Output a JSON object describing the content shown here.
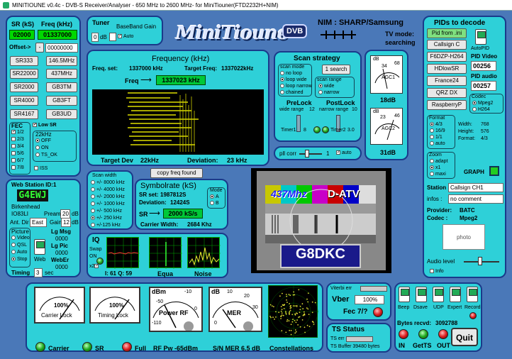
{
  "window_title": "MINITIOUNE v0.4c - DVB-S Receiver/Analyser - 650 MHz to 2600 MHz- for MiniTiouner(FTD2232H+NIM)",
  "left": {
    "sr_header": "SR (kS)",
    "freq_header": "Freq (kHz)",
    "sr_value": "02000",
    "freq_value": "01337000",
    "offset_label": "Offset->",
    "offset_btn": "-",
    "offset_value": "00000000",
    "presets": [
      [
        "SR333",
        "146.5MHz"
      ],
      [
        "SR22000",
        "437MHz"
      ],
      [
        "SR2000",
        "GB3TM"
      ],
      [
        "SR4000",
        "GB3FT"
      ],
      [
        "SR4167",
        "GB3UD"
      ]
    ],
    "fec_title": "FEC",
    "fec_items": [
      "1/2",
      "2/3",
      "3/4",
      "5/6",
      "6/7",
      "7/8"
    ],
    "low_sr": "Low SR",
    "khz22_title": "22kHz",
    "khz22_items": [
      "OFF",
      "ON",
      "TS_OK"
    ],
    "iss": "ISS"
  },
  "web": {
    "title": "Web Station ID:1",
    "callsign": "G4EWJ",
    "location": "Birkenhead",
    "locator": "IO83LI",
    "preamp_label": "Preamp",
    "preamp_value": "20",
    "preamp_unit": "dB",
    "ant_dir_label": "Ant. Dir",
    "ant_dir_value": "East",
    "gain_label": "Gain",
    "gain_value": "12",
    "gain_unit": "dB",
    "picture_title": "Picture",
    "picture_items": [
      "Video",
      "QSL",
      "Auto",
      "Stop"
    ],
    "lg_msg": "Lg Msg",
    "lg_msg_val": "0000",
    "lg_pic": "Lg Pic",
    "lg_pic_val": "0000",
    "weber": "WebEr",
    "weber_val": "0000",
    "web_btn": "Web",
    "timing_label": "Timing",
    "timing_value": "3",
    "timing_unit": "sec"
  },
  "tuner": {
    "title": "Tuner",
    "bb_gain": "BaseBand Gain",
    "gain_value": "0",
    "gain_unit": "dB",
    "auto": "Auto"
  },
  "logo": "MiniTioune",
  "logo_badge": "DVB",
  "nim": "NIM : SHARP/Samsung",
  "tv_mode_label": "TV mode:",
  "tv_mode_value": "searching",
  "frequency": {
    "title": "Frequency (kHz)",
    "freq_set_label": "Freq. set:",
    "freq_set": "1337000 kHz",
    "target_label": "Target Freq:",
    "target": "1337022kHz",
    "freq_arrow_label": "Freq",
    "freq_value": "1337023 kHz",
    "target_dev_label": "Target Dev",
    "target_dev": "22kHz",
    "deviation_label": "Deviation:",
    "deviation": "23 kHz"
  },
  "scan": {
    "title": "Scan strategy",
    "mode_title": "scan mode",
    "modes": [
      "no loop",
      "loop wide",
      "loop narrow",
      "chained"
    ],
    "search_btn": "1 search",
    "range_title": "scan range",
    "ranges": [
      "wide",
      "narrow"
    ],
    "prelock": "PreLock",
    "prelock_sub": "wide range",
    "prelock_val": "12",
    "postlock": "PostLock",
    "postlock_sub": "narrow range",
    "postlock_val": "10",
    "timer1": "Timer1",
    "timer1_val": "8",
    "timer2": "Timer2",
    "timer2_val": "3.0",
    "pll_label": "pll corr",
    "pll_val": "1",
    "auto": "auto"
  },
  "agc1": {
    "unit": "dB",
    "l1": "34",
    "l2": "68",
    "name": "AGC1",
    "value": "18dB"
  },
  "agc2": {
    "unit": "dB",
    "l1": "23",
    "l2": "46",
    "name": "AGC2",
    "value": "31dB"
  },
  "pids": {
    "title": "PIDs to decode",
    "pid_from_ini": "Pid from .ini",
    "presets": [
      "Callsign C",
      "F6DZP-H264",
      "HDlowSR",
      "France24",
      "QRZ DX",
      "RaspberryP"
    ],
    "auto_pid": "AutoPID",
    "pid_video_label": "PID Video",
    "pid_video": "00256",
    "pid_audio_label": "PID audio",
    "pid_audio": "00257",
    "codec_title": "Codec",
    "codecs": [
      "Mpeg2",
      "H264"
    ],
    "format_title": "Format",
    "formats": [
      "4/3",
      "16/9",
      "1/1",
      "auto"
    ],
    "width_label": "Width:",
    "width": "768",
    "height_label": "Height:",
    "height": "576",
    "format_label": "Format:",
    "format_val": "4/3",
    "zoom_title": "Zoom",
    "zooms": [
      "adapt",
      "x1",
      "maxi"
    ],
    "graph": "GRAPH",
    "station_label": "Station",
    "station_value": "Callsign CH1",
    "infos_label": "infos :",
    "infos_value": "no comment",
    "provider_label": "Provider:",
    "provider_value": "BATC",
    "codec_label": "Codec :",
    "codec_value": "Mpeg2",
    "photo": "photo",
    "audio_level": "Audio level",
    "info": "Info"
  },
  "scan_width": {
    "title": "Scan width",
    "items": [
      "+/- 8000 kHz",
      "+/- 4000 kHz",
      "+/- 2000 kHz",
      "+/- 1000 kHz",
      "+/- 500 kHz",
      "+/- 250 kHz",
      "+/-125 kHz"
    ],
    "selected_index": 5
  },
  "symbolrate": {
    "copy_btn": "copy freq found",
    "title": "Symbolrate (kS)",
    "sr_set_label": "SR set:",
    "sr_set": "1987812S",
    "deviation_label": "Deviation:",
    "deviation": "12424S",
    "sr_arrow_label": "SR",
    "sr_value": "2000 kS/s",
    "carrier_label": "Carrier Width:",
    "carrier": "2684 Khz",
    "mode_title": "Mode",
    "modes": [
      "A",
      "B"
    ]
  },
  "iq": {
    "title": "IQ",
    "swap": "Swap",
    "on": "ON",
    "x2": "x2",
    "values": "I: 61 Q: 59",
    "equa": "Equa",
    "noise": "Noise"
  },
  "video": {
    "freq_text": "437Mhz",
    "mode_text": "D-ATV",
    "callsign_text": "G8DKC"
  },
  "meters": {
    "carrier_pct": "100%",
    "carrier_label": "Carrier Lock",
    "timing_pct": "100%",
    "timing_label": "Timing Lock",
    "power_unit": "dBm",
    "power_ticks": [
      "-10",
      "-50",
      "-110",
      "0"
    ],
    "power_label": "Power RF",
    "mer_unit": "dB",
    "mer_ticks": [
      "10",
      "20",
      "0",
      "30"
    ],
    "mer_label": "MER"
  },
  "status_row": {
    "carrier": "Carrier",
    "sr": "SR",
    "full": "Full",
    "rf_pw": "RF Pw -65dBm",
    "sn_mer": "S/N MER  6.5 dB",
    "constellations": "Constellations"
  },
  "viterbi": {
    "title": "Viterbi err",
    "vber_label": "Vber",
    "vber_value": "100%",
    "fec_label": "Fec 7/?"
  },
  "ts": {
    "title": "TS Status",
    "ts_err": "TS err",
    "ts_buffer": "TS Buffer 39480 bytes"
  },
  "controls": {
    "switches": [
      "Beep",
      "Dsave",
      "UDP",
      "Expert",
      "Record"
    ],
    "bytes_label": "Bytes recvd:",
    "bytes_value": "3092788",
    "quit": "Quit",
    "leds": [
      "IN",
      "GetTS",
      "OUT"
    ]
  }
}
